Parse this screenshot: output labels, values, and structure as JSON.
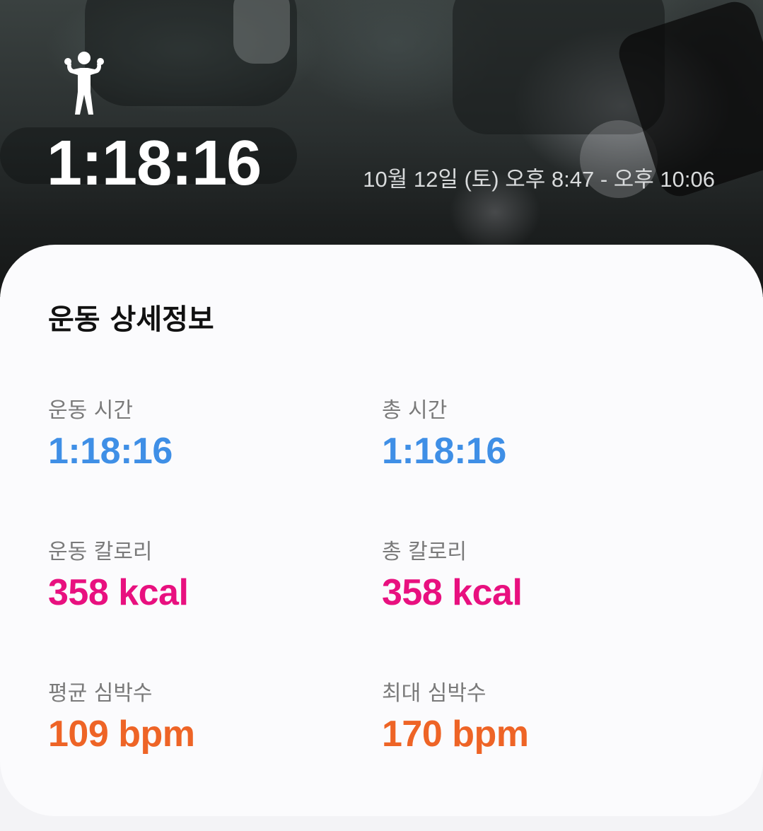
{
  "colors": {
    "time_color": "#3f8fe6",
    "calorie_color": "#e8107f",
    "heart_color": "#ee6426",
    "label_color": "#7a7a7a",
    "title_color": "#111111"
  },
  "header": {
    "icon": "person-flexing-icon",
    "duration": "1:18:16",
    "time_range": "10월 12일 (토) 오후 8:47 - 오후 10:06"
  },
  "details": {
    "title": "운동 상세정보",
    "stats": [
      {
        "label": "운동 시간",
        "value": "1:18:16"
      },
      {
        "label": "총 시간",
        "value": "1:18:16"
      },
      {
        "label": "운동 칼로리",
        "value": "358 kcal"
      },
      {
        "label": "총 칼로리",
        "value": "358 kcal"
      },
      {
        "label": "평균 심박수",
        "value": "109 bpm"
      },
      {
        "label": "최대 심박수",
        "value": "170 bpm"
      }
    ]
  }
}
